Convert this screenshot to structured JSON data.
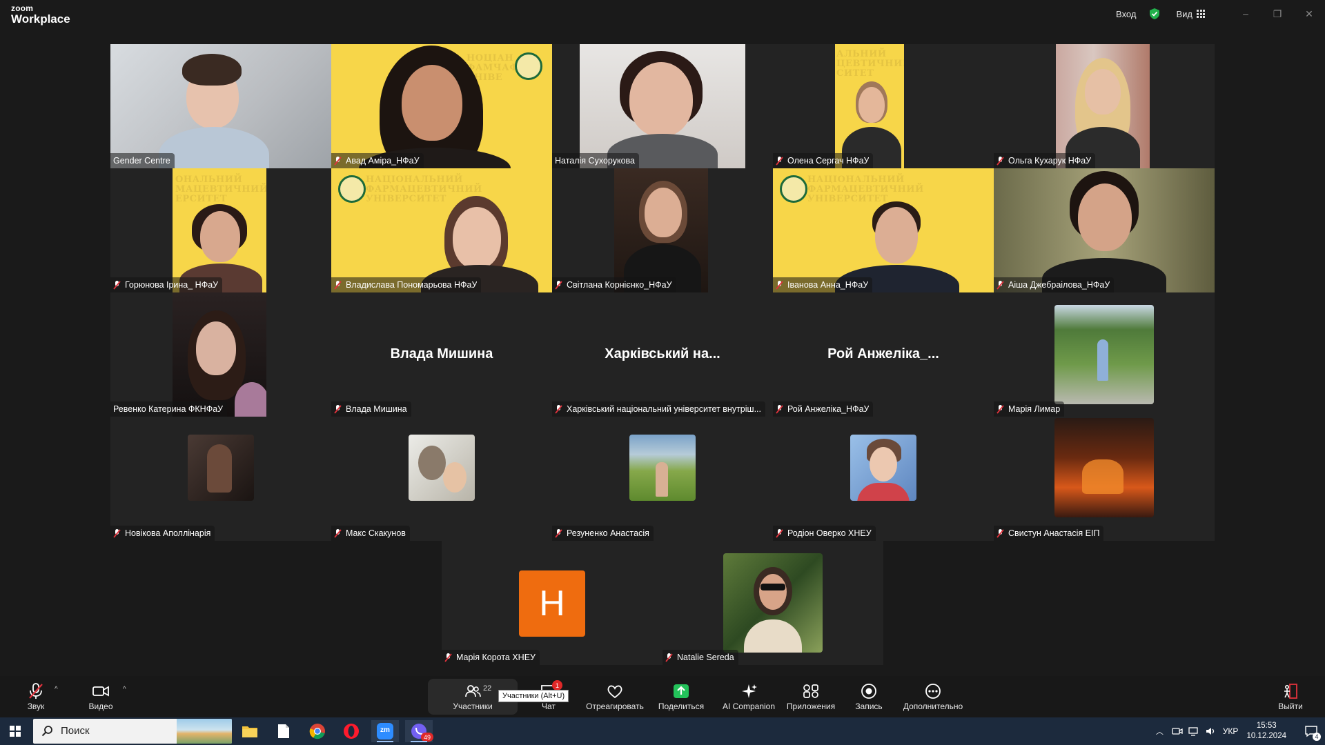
{
  "app": {
    "brand_small": "zoom",
    "brand_name": "Workplace"
  },
  "titlebar": {
    "sign_in": "Вход",
    "view": "Вид",
    "minimize": "–",
    "restore": "❐",
    "close": "✕"
  },
  "participants": [
    {
      "name": "Gender Centre",
      "muted": false,
      "active_speaker": true
    },
    {
      "name": "Авад Аміра_НФаУ",
      "muted": true
    },
    {
      "name": "Наталія Сухорукова",
      "muted": false
    },
    {
      "name": "Олена Сергач НФаУ",
      "muted": true
    },
    {
      "name": "Ольга Кухарук НФаУ",
      "muted": true
    },
    {
      "name": "Горюнова Ірина_ НФаУ",
      "muted": true
    },
    {
      "name": "Владислава Пономарьова НФаУ",
      "muted": true
    },
    {
      "name": "Світлана Корнієнко_НФаУ",
      "muted": true
    },
    {
      "name": "Іванова Анна_НФаУ",
      "muted": true
    },
    {
      "name": "Аіша Джебраілова_НФаУ",
      "muted": true
    },
    {
      "name": "Ревенко Катерина ФКНФаУ",
      "muted": false
    },
    {
      "name": "Влада Мишина",
      "muted": true,
      "big_label": "Влада Мишина"
    },
    {
      "name": "Харківський національний університет внутріш...",
      "muted": true,
      "big_label": "Харківський на..."
    },
    {
      "name": "Рой Анжеліка_НФаУ",
      "muted": true,
      "big_label": "Рой Анжеліка_..."
    },
    {
      "name": "Марія Лимар",
      "muted": true
    },
    {
      "name": "Новікова Аполлінарія",
      "muted": true
    },
    {
      "name": "Макс Скакунов",
      "muted": true
    },
    {
      "name": "Резуненко Анастасія",
      "muted": true
    },
    {
      "name": "Родіон Оверко ХНЕУ",
      "muted": true
    },
    {
      "name": "Свистун Анастасія ЕІП",
      "muted": true
    },
    {
      "name": "Марія Корота ХНЕУ",
      "muted": true,
      "avatar_letter": "Н"
    },
    {
      "name": "Natalie Sereda",
      "muted": true
    }
  ],
  "university_overlay": {
    "full": [
      "НАЦІОНАЛЬНИЙ",
      "ФАРМАЦЕВТИЧНИЙ",
      "УНІВЕРСИТЕТ"
    ],
    "cropped_a": [
      "НОЦІАН",
      "ФАМЧАФ",
      "УНІВЕ"
    ],
    "cropped_b": [
      "АЛЬНИЙ",
      "ЦЕВТИЧНИЙ",
      "СИТЕТ"
    ],
    "cropped_c": [
      "ОНАЛЬНИЙ",
      "МАЦЕВТИЧНИЙ",
      "ЕРСИТЕТ"
    ]
  },
  "toolbar": {
    "audio": "Звук",
    "video": "Видео",
    "participants": "Участники",
    "participants_count": "22",
    "chat": "Чат",
    "chat_badge": "1",
    "react": "Отреагировать",
    "share": "Поделиться",
    "ai": "AI Companion",
    "apps": "Приложения",
    "record": "Запись",
    "more": "Дополнительно",
    "leave": "Выйти",
    "tooltip": "Участники (Alt+U)"
  },
  "taskbar": {
    "search_placeholder": "Поиск",
    "lang": "УКР",
    "time": "15:53",
    "date": "10.12.2024",
    "zoom_label": "zm",
    "viber_badge": "49",
    "notif_count": "4"
  },
  "colors": {
    "accent_green": "#2ecc71",
    "muted_red": "#e0323c",
    "avatar_orange": "#ef6c0f",
    "share_green": "#23c25a",
    "uni_yellow": "#f7d649"
  }
}
